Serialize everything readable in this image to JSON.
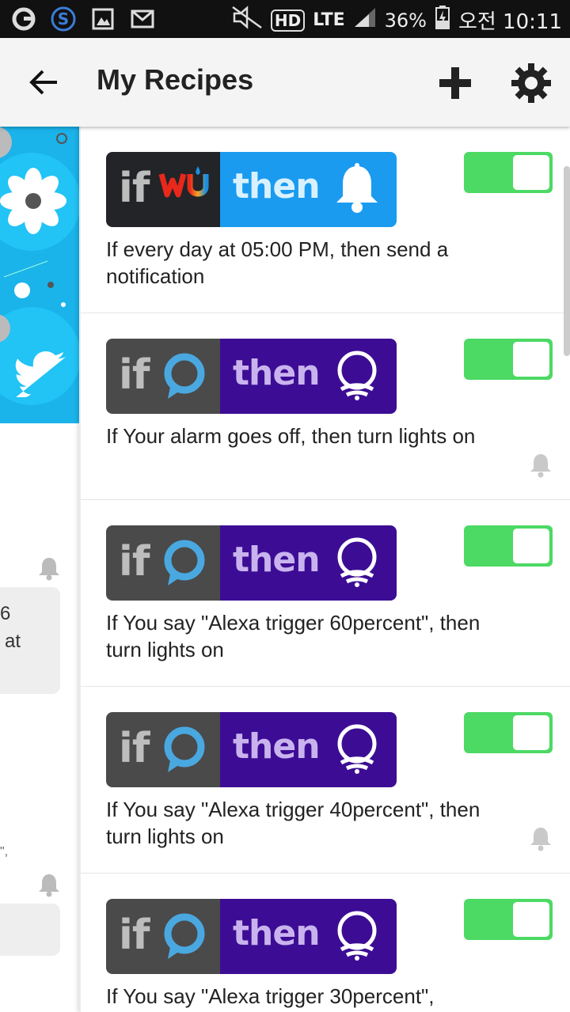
{
  "status_bar": {
    "lte": "LTE",
    "battery": "36%",
    "time": "오전 10:11",
    "hd": "HD"
  },
  "app_bar": {
    "title": "My Recipes"
  },
  "colors": {
    "toggle_on": "#4cd964",
    "weather_if_bg": "#222428",
    "notification_then_bg": "#1a9bf0",
    "alexa_if_bg": "#4a4a4a",
    "hue_then_bg": "#3c0d94",
    "hero_bg": "#1ab3ea"
  },
  "left_panel": {
    "card1_text": [
      "6",
      "at"
    ],
    "card2_text": "\","
  },
  "recipes": [
    {
      "if_word": "if",
      "then_word": "then",
      "if_service": "weather-underground-icon",
      "then_service": "notification-bell-icon",
      "description": "If every day at 05:00 PM, then send a notification",
      "enabled": true,
      "muted": false
    },
    {
      "if_word": "if",
      "then_word": "then",
      "if_service": "alexa-icon",
      "then_service": "hue-lights-icon",
      "description": "If Your alarm goes off, then turn lights on",
      "enabled": true,
      "muted": true
    },
    {
      "if_word": "if",
      "then_word": "then",
      "if_service": "alexa-icon",
      "then_service": "hue-lights-icon",
      "description": "If You say \"Alexa trigger 60percent\", then turn lights on",
      "enabled": true,
      "muted": false
    },
    {
      "if_word": "if",
      "then_word": "then",
      "if_service": "alexa-icon",
      "then_service": "hue-lights-icon",
      "description": "If You say \"Alexa trigger 40percent\", then turn lights on",
      "enabled": true,
      "muted": true
    },
    {
      "if_word": "if",
      "then_word": "then",
      "if_service": "alexa-icon",
      "then_service": "hue-lights-icon",
      "description": "If You say \"Alexa trigger 30percent\",",
      "enabled": true,
      "muted": false
    }
  ]
}
